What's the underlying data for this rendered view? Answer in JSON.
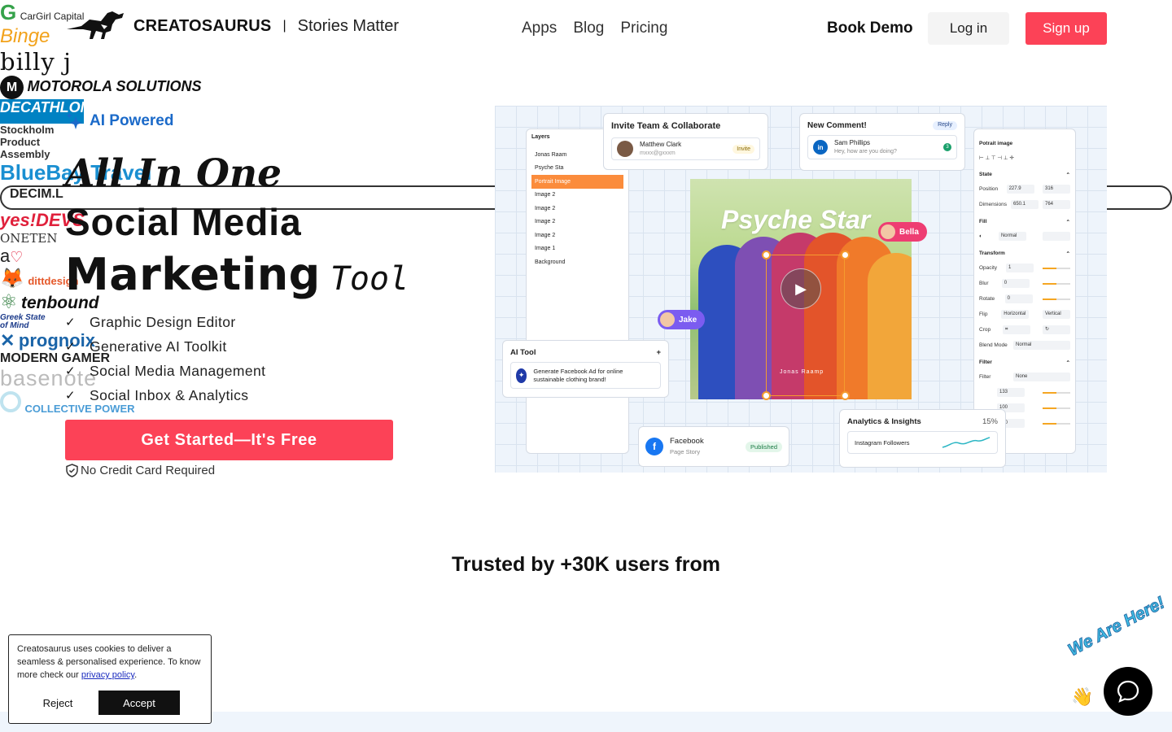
{
  "header": {
    "brand_name": "CREATOSAURUS",
    "brand_separator": "|",
    "brand_tagline": "Stories Matter",
    "nav": [
      "Apps",
      "Blog",
      "Pricing"
    ],
    "book_demo": "Book Demo",
    "login": "Log in",
    "signup": "Sign up"
  },
  "hero": {
    "badge": "AI Powered",
    "line1": "All In One",
    "line2": "Social Media",
    "line3_strong": "Marketing",
    "line3_light": "Tool",
    "features": [
      "Graphic Design Editor",
      "Generative AI Toolkit",
      "Social Media Management",
      "Social Inbox & Analytics"
    ],
    "cta": "Get Started—It's Free",
    "no_credit": "No Credit Card Required"
  },
  "mockup": {
    "layers_title": "Layers",
    "layers": [
      "Jonas Raam",
      "Psyche Sta",
      "Portrait Image",
      "Image 2",
      "Image 2",
      "Image 2",
      "Image 2",
      "Image 1",
      "Background"
    ],
    "invite_title": "Invite Team & Collaborate",
    "invite_name": "Matthew Clark",
    "invite_email": "mxxx@gxxxm",
    "invite_btn": "Invite",
    "comment_title": "New Comment!",
    "comment_reply": "Reply",
    "comment_name": "Sam Phillips",
    "comment_text": "Hey, how are you doing?",
    "comment_count": "3",
    "li": "in",
    "props_title": "Potrait image",
    "props_state": "State",
    "props_position": "Position",
    "pos_x": "227.9",
    "pos_y": "316",
    "props_dimensions": "Dimensions",
    "dim_w": "650.1",
    "dim_h": "764",
    "props_fill": "Fill",
    "fill_mode": "Normal",
    "props_transform": "Transform",
    "opacity_label": "Opacity",
    "opacity_val": "1",
    "blur_label": "Blur",
    "blur_val": "0",
    "rotate_label": "Rotate",
    "rotate_val": "0",
    "flip_label": "Flip",
    "flip_h": "Horizontal",
    "flip_v": "Vertical",
    "crop_label": "Crop",
    "blend_label": "Blend Mode",
    "blend_val": "Normal",
    "props_filter": "Filter",
    "filter_label": "Filter",
    "filter_val": "None",
    "f1": "133",
    "f2": "100",
    "f3": "100",
    "art_title": "Psyche Star",
    "art_caption": "Jonas Raamp",
    "tag_bella": "Bella",
    "tag_jake": "Jake",
    "ai_title": "AI Tool",
    "ai_plus": "+",
    "ai_text": "Generate Facebook Ad for online sustainable clothing brand!",
    "fb_title": "Facebook",
    "fb_sub": "Page Story",
    "fb_status": "Published",
    "fb_letter": "f",
    "analytics_title": "Analytics & Insights",
    "analytics_pct": "15%",
    "analytics_metric": "Instagram Followers"
  },
  "trusted": {
    "title": "Trusted by +30K users from",
    "row1": [
      "CarGirl Capital",
      "Binge",
      "billy j",
      "MOTOROLA SOLUTIONS",
      "DECATHLON",
      "Stockholm Product Assembly",
      "BlueBay Travel",
      "DECIM.L",
      "yes!DEVS",
      "ONETEN"
    ],
    "row2": [
      "a",
      "dittdesign",
      "tenbound",
      "Greek State of Mind",
      "prognoix",
      "MODERN GAMER",
      "basenote",
      "COLLECTIVE POWER"
    ]
  },
  "cookie": {
    "text": "Creatosaurus uses cookies to deliver a seamless & personalised experience. To know more check our",
    "link": "privacy policy",
    "end": ".",
    "reject": "Reject",
    "accept": "Accept"
  },
  "chat": {
    "banner": "We Are Here!"
  },
  "colors": {
    "accent": "#fc4257",
    "badge_blue": "#1b6ac9",
    "chat_bg": "#000000"
  }
}
